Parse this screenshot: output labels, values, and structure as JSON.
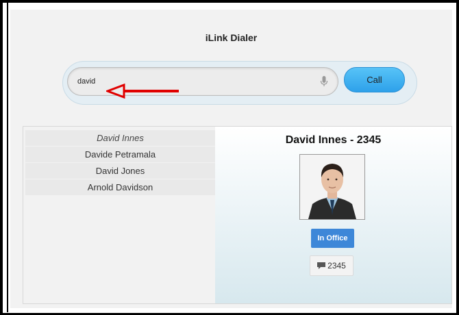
{
  "app": {
    "title": "iLink Dialer"
  },
  "search": {
    "value": "david",
    "placeholder": ""
  },
  "toolbar": {
    "call_label": "Call"
  },
  "results": [
    {
      "name": "David Innes",
      "selected": true
    },
    {
      "name": "Davide Petramala",
      "selected": false
    },
    {
      "name": "David Jones",
      "selected": false
    },
    {
      "name": "Arnold Davidson",
      "selected": false
    }
  ],
  "detail": {
    "title": "David Innes - 2345",
    "status": "In Office",
    "extension": "2345"
  },
  "colors": {
    "call_button": "#2ea1ea",
    "status_badge": "#3d87d8",
    "annotation_arrow": "#e00000"
  },
  "icons": [
    "microphone-icon",
    "message-icon",
    "annotation-arrow"
  ]
}
